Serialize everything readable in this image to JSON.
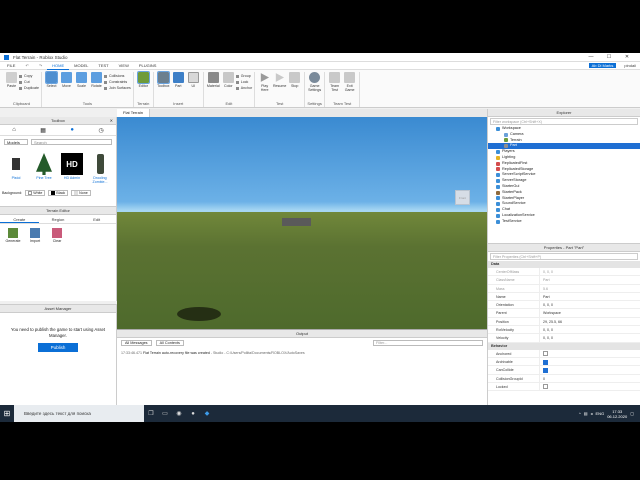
{
  "window": {
    "title": "Flat Terrain - Roblox Studio",
    "min": "—",
    "max": "☐",
    "close": "✕"
  },
  "menu": {
    "file": "FILE",
    "tabs": [
      "HOME",
      "MODEL",
      "TEST",
      "VIEW",
      "PLUGINS"
    ],
    "team_create": "Ab Di Marks",
    "user": "pindaii"
  },
  "ribbon": {
    "clipboard": {
      "label": "Clipboard",
      "paste": "Paste",
      "copy": "Copy",
      "cut": "Cut",
      "duplicate": "Duplicate"
    },
    "tools": {
      "label": "Tools",
      "items": [
        "Select",
        "Move",
        "Scale",
        "Rotate"
      ],
      "collisions": "Collisions",
      "constraints": "Constraints",
      "join": "Join Surfaces"
    },
    "terrain": {
      "label": "Terrain",
      "editor": "Editor"
    },
    "insert": {
      "label": "Insert",
      "items": [
        "Toolbox",
        "Part",
        "UI"
      ]
    },
    "edit": {
      "label": "Edit",
      "items": [
        "Material",
        "Color"
      ],
      "group": "Group",
      "lock": "Lock",
      "anchor": "Anchor"
    },
    "test": {
      "label": "Test",
      "items": [
        "Play",
        "Resume",
        "Stop"
      ],
      "play_here": "Here"
    },
    "settings": {
      "label": "Settings",
      "game_settings": "Game Settings"
    },
    "team_test": {
      "label": "Team Test",
      "items": [
        "Team Test",
        "Exit Game"
      ]
    }
  },
  "toolbox": {
    "title": "Toolbox",
    "category": "Models",
    "search_placeholder": "Search",
    "items": [
      {
        "label": "Pistol"
      },
      {
        "label": "Pine Tree"
      },
      {
        "label": "HD Admin"
      },
      {
        "label": "Drooling Zombie..."
      }
    ],
    "background_label": "Background:",
    "backgrounds": [
      "White",
      "Black",
      "None"
    ]
  },
  "terrain_editor": {
    "title": "Terrain Editor",
    "tabs": [
      "Create",
      "Region",
      "Edit"
    ],
    "tools": [
      "Generate",
      "Import",
      "Clear"
    ]
  },
  "asset_manager": {
    "title": "Asset Manager",
    "message": "You need to publish the game to start using Asset Manager.",
    "publish": "Publish"
  },
  "viewport": {
    "tab": "Flat Terrain",
    "cube_label": "Front"
  },
  "output": {
    "title": "Output",
    "filters": [
      "All Messages",
      "All Contexts"
    ],
    "filter_placeholder": "Filter...",
    "time": "17:33:46.471",
    "message": "Flat Terrain auto-recovery file was created",
    "path": " - Studio - C:/Users/Pollita/Documents/ROBLOX/AutoSaves"
  },
  "explorer": {
    "title": "Explorer",
    "filter_placeholder": "Filter workspace (Ctrl+Shift+X)",
    "tree": [
      {
        "label": "Workspace",
        "depth": 0,
        "color": "#3c8fd8"
      },
      {
        "label": "Camera",
        "depth": 1,
        "color": "#6aa0d8"
      },
      {
        "label": "Terrain",
        "depth": 1,
        "color": "#6e9d3b"
      },
      {
        "label": "Part",
        "depth": 1,
        "color": "#8f8f8f",
        "selected": true
      },
      {
        "label": "Players",
        "depth": 0,
        "color": "#3c8fd8"
      },
      {
        "label": "Lighting",
        "depth": 0,
        "color": "#e6b422"
      },
      {
        "label": "ReplicatedFirst",
        "depth": 0,
        "color": "#d44c4c"
      },
      {
        "label": "ReplicatedStorage",
        "depth": 0,
        "color": "#d44c4c"
      },
      {
        "label": "ServerScriptService",
        "depth": 0,
        "color": "#3c8fd8"
      },
      {
        "label": "ServerStorage",
        "depth": 0,
        "color": "#3c8fd8"
      },
      {
        "label": "StarterGui",
        "depth": 0,
        "color": "#3c8fd8"
      },
      {
        "label": "StarterPack",
        "depth": 0,
        "color": "#8f6a3c"
      },
      {
        "label": "StarterPlayer",
        "depth": 0,
        "color": "#3c8fd8"
      },
      {
        "label": "SoundService",
        "depth": 0,
        "color": "#3c8fd8"
      },
      {
        "label": "Chat",
        "depth": 0,
        "color": "#3c8fd8"
      },
      {
        "label": "LocalizationService",
        "depth": 0,
        "color": "#3c8fd8"
      },
      {
        "label": "TestService",
        "depth": 0,
        "color": "#3c8fd8"
      }
    ]
  },
  "properties": {
    "title": "Properties - Part \"Part\"",
    "filter_placeholder": "Filter Properties (Ctrl+Shift+P)",
    "data_label": "Data",
    "rows": [
      {
        "k": "CenterOfMass",
        "v": "0, 0, 0",
        "dim": true
      },
      {
        "k": "ClassName",
        "v": "Part",
        "dim": true
      },
      {
        "k": "Mass",
        "v": "5.6",
        "dim": true
      },
      {
        "k": "Name",
        "v": "Part"
      },
      {
        "k": "Orientation",
        "v": "0, 0, 0"
      },
      {
        "k": "Parent",
        "v": "Workspace"
      },
      {
        "k": "Position",
        "v": "29, 25.5, 66"
      },
      {
        "k": "RotVelocity",
        "v": "0, 0, 0"
      },
      {
        "k": "Velocity",
        "v": "0, 0, 0"
      }
    ],
    "behavior_label": "Behavior",
    "behavior": [
      {
        "k": "Anchored",
        "checked": false
      },
      {
        "k": "Archivable",
        "checked": true
      },
      {
        "k": "CanCollide",
        "checked": true
      },
      {
        "k": "CollisionGroupId",
        "v": "0"
      },
      {
        "k": "Locked",
        "checked": false
      }
    ]
  },
  "taskbar": {
    "search_placeholder": "Введите здесь текст для поиска",
    "lang": "ENG",
    "time": "17:33",
    "date": "06.12.2020"
  }
}
